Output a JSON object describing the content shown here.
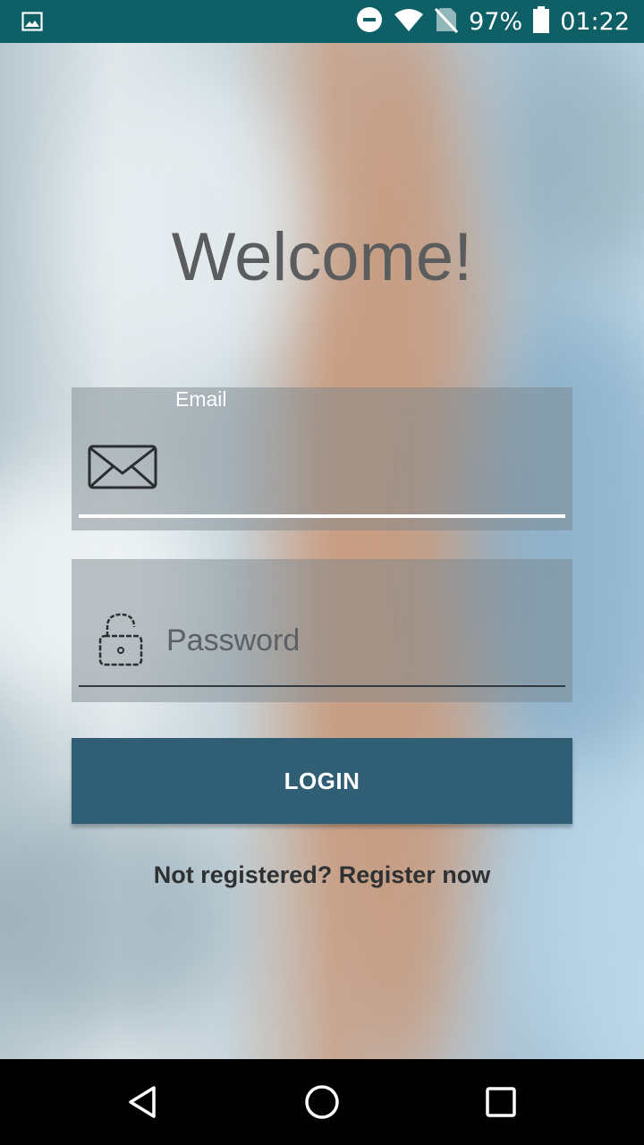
{
  "status_bar": {
    "battery": "97%",
    "time": "01:22",
    "icons": [
      "image-notification-icon",
      "do-not-disturb-icon",
      "wifi-icon",
      "no-sim-icon",
      "battery-icon"
    ]
  },
  "login": {
    "title": "Welcome!",
    "email": {
      "label": "Email",
      "value": "",
      "icon": "mail-icon"
    },
    "password": {
      "placeholder": "Password",
      "value": "",
      "icon": "unlock-icon"
    },
    "login_label": "LOGIN",
    "register_text": "Not registered? Register now"
  },
  "nav_bar": {
    "icons": [
      "back-icon",
      "home-icon",
      "recents-icon"
    ]
  },
  "colors": {
    "status_bar": "#0e5f66",
    "button": "#2f5e75",
    "title": "#5a5c5e"
  }
}
